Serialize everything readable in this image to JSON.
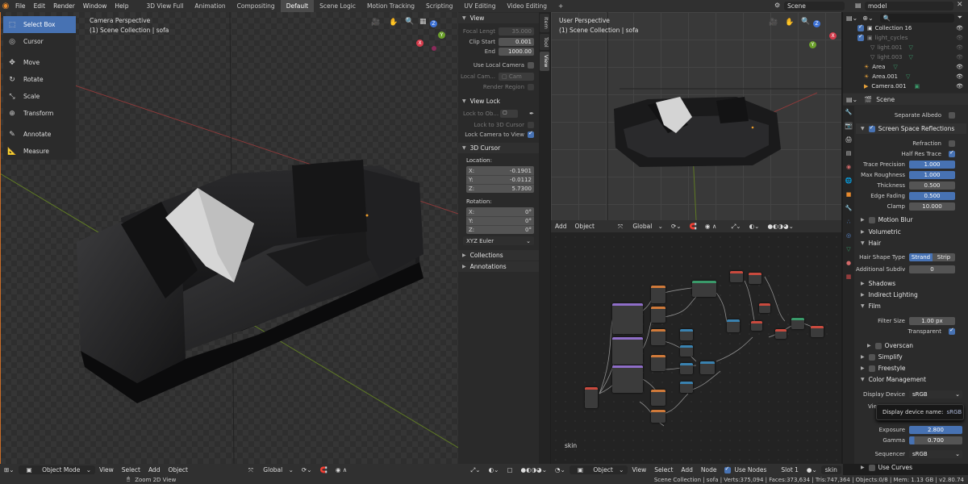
{
  "topbar": {
    "menus": [
      "File",
      "Edit",
      "Render",
      "Window",
      "Help"
    ],
    "workspaces": [
      "3D View Full",
      "Animation",
      "Compositing",
      "Default",
      "Scene Logic",
      "Motion Tracking",
      "Scripting",
      "UV Editing",
      "Video Editing"
    ],
    "active_workspace": "Default",
    "add_tab": "+",
    "scene": "Scene",
    "view_layer": "model"
  },
  "left_viewport": {
    "title": "Camera Perspective",
    "subtitle": "(1) Scene Collection | sofa",
    "header": {
      "mode": "Object Mode",
      "menus": [
        "View",
        "Select",
        "Add",
        "Object"
      ],
      "transform": "Global"
    }
  },
  "toolbar": {
    "tools": [
      {
        "label": "Select Box",
        "icon": "select-box-icon",
        "active": true
      },
      {
        "label": "Cursor",
        "icon": "cursor-icon",
        "active": false
      },
      {
        "label": "Move",
        "icon": "move-icon",
        "active": false
      },
      {
        "label": "Rotate",
        "icon": "rotate-icon",
        "active": false
      },
      {
        "label": "Scale",
        "icon": "scale-icon",
        "active": false
      },
      {
        "label": "Transform",
        "icon": "transform-icon",
        "active": false
      },
      {
        "label": "Annotate",
        "icon": "annotate-icon",
        "active": false
      },
      {
        "label": "Measure",
        "icon": "measure-icon",
        "active": false
      }
    ]
  },
  "npanel": {
    "view_header": "View",
    "focal_length": {
      "label": "Focal Lengt",
      "value": "35.000"
    },
    "clip_start": {
      "label": "Clip Start",
      "value": "0.001"
    },
    "clip_end": {
      "label": "End",
      "value": "1000.00"
    },
    "use_local_camera": "Use Local Camera",
    "local_camera": {
      "label": "Local Cam...",
      "value": "Cam"
    },
    "render_region": "Render Region",
    "view_lock_header": "View Lock",
    "lock_to_object": "Lock to Ob...",
    "lock_to_cursor": "Lock to 3D Cursor",
    "lock_camera": "Lock Camera to View",
    "cursor_header": "3D Cursor",
    "location_label": "Location:",
    "location": [
      {
        "axis": "X:",
        "value": "-0.1901"
      },
      {
        "axis": "Y:",
        "value": "-0.0112"
      },
      {
        "axis": "Z:",
        "value": "5.7300"
      }
    ],
    "rotation_label": "Rotation:",
    "rotation": [
      {
        "axis": "X:",
        "value": "0°"
      },
      {
        "axis": "Y:",
        "value": "0°"
      },
      {
        "axis": "Z:",
        "value": "0°"
      }
    ],
    "rotation_mode": "XYZ Euler",
    "collections_header": "Collections",
    "annotations_header": "Annotations",
    "tabs": [
      "Item",
      "Tool",
      "View"
    ],
    "active_tab": "View"
  },
  "right_viewport": {
    "title": "User Perspective",
    "subtitle": "(1) Scene Collection | sofa",
    "header": {
      "menus": [
        "Add",
        "Object"
      ],
      "transform": "Global"
    }
  },
  "node_editor": {
    "header": {
      "type": "Object",
      "menus": [
        "View",
        "Select",
        "Add",
        "Node"
      ],
      "use_nodes": "Use Nodes",
      "slot": "Slot 1",
      "material": "skin"
    },
    "material_label": "skin"
  },
  "outliner": {
    "search_placeholder": "",
    "items": [
      {
        "name": "Collection 16",
        "dim": false
      },
      {
        "name": "light_cycles",
        "dim": true
      },
      {
        "name": "light.001",
        "dim": true
      },
      {
        "name": "light.003",
        "dim": true
      },
      {
        "name": "Area",
        "dim": false
      },
      {
        "name": "Area.001",
        "dim": false
      },
      {
        "name": "Camera.001",
        "dim": false
      }
    ]
  },
  "properties": {
    "header_scene": "Scene",
    "separate_albedo": "Separate Albedo",
    "ssr_header": "Screen Space Reflections",
    "refraction": "Refraction",
    "half_res_trace": "Half Res Trace",
    "trace_precision": {
      "label": "Trace Precision",
      "value": "1.000"
    },
    "max_roughness": {
      "label": "Max Roughness",
      "value": "1.000"
    },
    "thickness": {
      "label": "Thickness",
      "value": "0.500"
    },
    "edge_fading": {
      "label": "Edge Fading",
      "value": "0.500"
    },
    "clamp": {
      "label": "Clamp",
      "value": "10.000"
    },
    "motion_blur": "Motion Blur",
    "volumetric": "Volumetric",
    "hair": "Hair",
    "hair_shape_type": {
      "label": "Hair Shape Type",
      "options": [
        "Strand",
        "Strip"
      ]
    },
    "additional_subdiv": {
      "label": "Additional Subdiv",
      "value": "0"
    },
    "shadows": "Shadows",
    "indirect_lighting": "Indirect Lighting",
    "film": "Film",
    "filter_size": {
      "label": "Filter Size",
      "value": "1.00 px"
    },
    "transparent": "Transparent",
    "overscan": "Overscan",
    "simplify": "Simplify",
    "freestyle": "Freestyle",
    "color_management": "Color Management",
    "display_device": {
      "label": "Display Device",
      "value": "sRGB"
    },
    "tooltip": {
      "label": "Display device name:",
      "value": "sRGB"
    },
    "view_label": "Vie",
    "exposure": {
      "label": "Exposure",
      "value": "2.800"
    },
    "gamma": {
      "label": "Gamma",
      "value": "0.700"
    },
    "sequencer": {
      "label": "Sequencer",
      "value": "sRGB"
    },
    "use_curves": "Use Curves"
  },
  "statusbar": {
    "hint": "Zoom 2D View",
    "stats": "Scene Collection | sofa | Verts:375,094 | Faces:373,634 | Tris:747,364 | Objects:0/8 | Mem: 1.13 GB | v2.80.74"
  }
}
